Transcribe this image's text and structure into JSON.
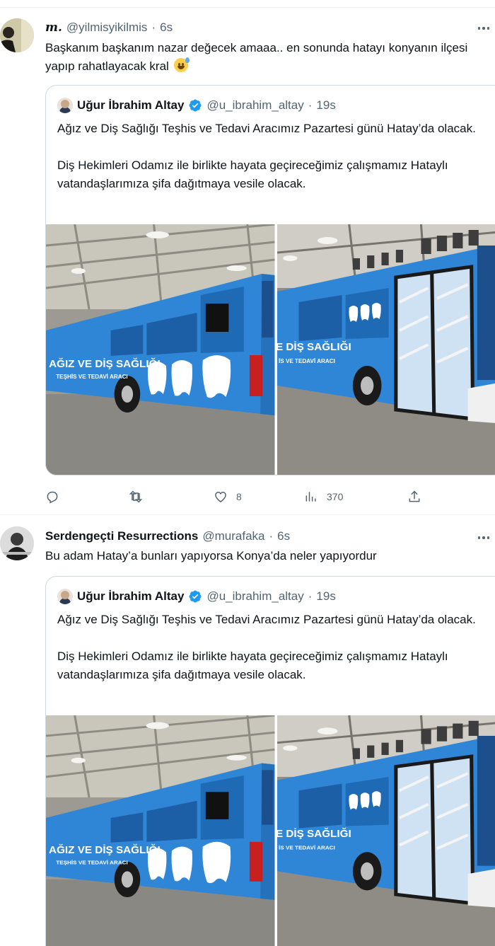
{
  "tweets": [
    {
      "display_name": "m.",
      "handle": "@yilmisyikilmis",
      "separator": "·",
      "time": "6s",
      "text": "Başkanım başkanım nazar değecek amaaa.. en sonunda hatayı konyanın ilçesi yapıp rahatlayacak kral",
      "emoji": "sweat-smile-emoji",
      "quote": {
        "display_name": "Uğur İbrahim Altay",
        "handle": "@u_ibrahim_altay",
        "separator": "·",
        "time": "19s",
        "paragraph1": "Ağız ve Diş Sağlığı Teşhis ve Tedavi Aracımız Pazartesi günü Hatay’da olacak.",
        "paragraph2": "Diş Hekimleri Odamız ile birlikte hayata geçireceğimiz çalışmamız Hataylı vatandaşlarımıza şifa dağıtmaya vesile olacak.",
        "bus_text_main": "AĞIZ VE DİŞ SAĞLIĞI",
        "bus_text_sub": "TEŞHİS VE TEDAVİ ARACI",
        "bus_text_main_crop": "E DİŞ SAĞLIĞI",
        "bus_text_sub_crop": "İS VE TEDAVİ ARACI"
      },
      "actions": {
        "reply_count": "",
        "retweet_count": "",
        "like_count": "8",
        "views_count": "370"
      }
    },
    {
      "display_name": "Serdengeçti Resurrections",
      "handle": "@murafaka",
      "separator": "·",
      "time": "6s",
      "text": "Bu adam Hatay’a bunları yapıyorsa Konya’da neler yapıyordur",
      "quote": {
        "display_name": "Uğur İbrahim Altay",
        "handle": "@u_ibrahim_altay",
        "separator": "·",
        "time": "19s",
        "paragraph1": "Ağız ve Diş Sağlığı Teşhis ve Tedavi Aracımız Pazartesi günü Hatay’da olacak.",
        "paragraph2": "Diş Hekimleri Odamız ile birlikte hayata geçireceğimiz çalışmamız Hataylı vatandaşlarımıza şifa dağıtmaya vesile olacak.",
        "bus_text_main": "AĞIZ VE DİŞ SAĞLIĞI",
        "bus_text_sub": "TEŞHİS VE TEDAVİ ARACI",
        "bus_text_main_crop": "E DİŞ SAĞLIĞI",
        "bus_text_sub_crop": "İS VE TEDAVİ ARACI"
      }
    }
  ],
  "colors": {
    "text": "#0f1419",
    "secondary": "#536471",
    "border": "#cfd9de",
    "verified": "#1d9bf0",
    "bus": "#2f86d6"
  }
}
